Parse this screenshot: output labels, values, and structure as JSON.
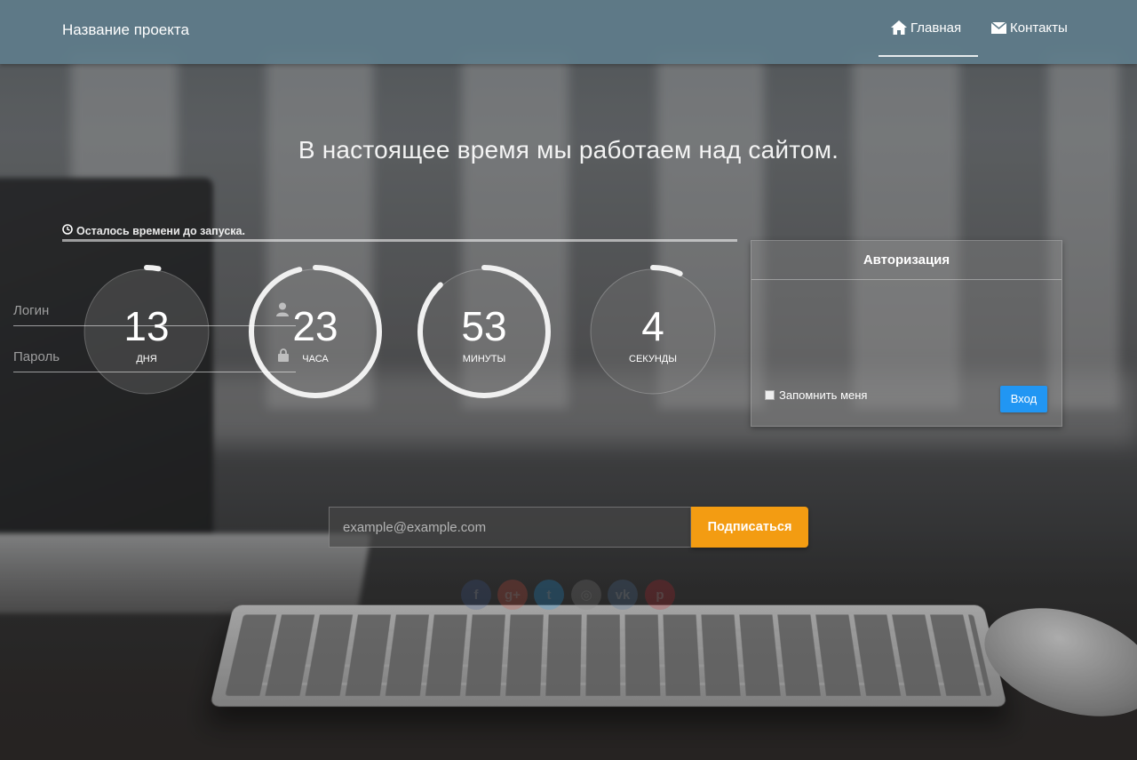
{
  "navbar": {
    "brand": "Название проекта",
    "items": [
      {
        "label": "Главная",
        "icon": "home-icon",
        "active": true
      },
      {
        "label": "Контакты",
        "icon": "envelope-icon",
        "active": false
      }
    ]
  },
  "headline": "В настоящее время мы работаем над сайтом.",
  "countdown": {
    "label": "Осталось времени до запуска.",
    "units": [
      {
        "value": "13",
        "unit": "дня",
        "fill": 0.03
      },
      {
        "value": "23",
        "unit": "часа",
        "fill": 0.96
      },
      {
        "value": "53",
        "unit": "минуты",
        "fill": 0.88
      },
      {
        "value": "4",
        "unit": "секунды",
        "fill": 0.07
      }
    ]
  },
  "login": {
    "title": "Авторизация",
    "login_placeholder": "Логин",
    "password_placeholder": "Пароль",
    "remember_label": "Запомнить меня",
    "submit_label": "Вход"
  },
  "subscribe": {
    "placeholder": "example@example.com",
    "button_label": "Подписаться"
  },
  "social": [
    {
      "name": "facebook",
      "glyph": "f",
      "color": "#3b5998"
    },
    {
      "name": "google-plus",
      "glyph": "g+",
      "color": "#dd4b39"
    },
    {
      "name": "twitter",
      "glyph": "t",
      "color": "#1da1f2"
    },
    {
      "name": "instagram",
      "glyph": "◎",
      "color": "#8a8a8a"
    },
    {
      "name": "vk",
      "glyph": "vk",
      "color": "#4c75a3"
    },
    {
      "name": "pinterest",
      "glyph": "p",
      "color": "#cb2027"
    }
  ],
  "colors": {
    "navbar": "#607d8b",
    "login_button": "#2196f3",
    "subscribe_button": "#f39c12"
  }
}
